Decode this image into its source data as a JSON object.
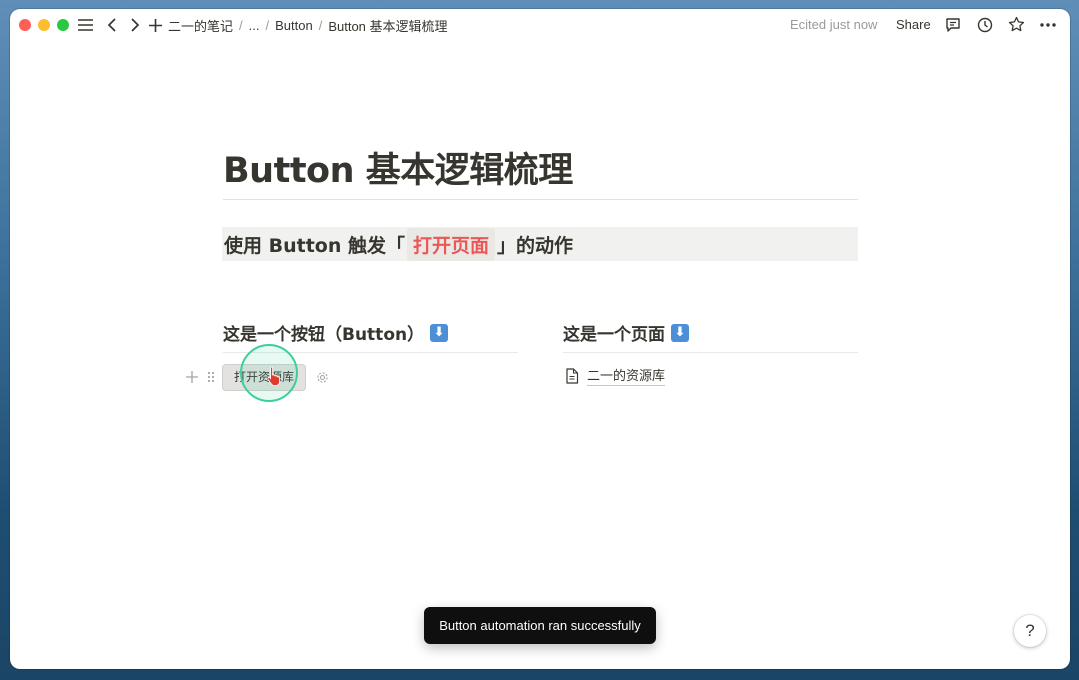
{
  "breadcrumb": {
    "items": [
      "二一的笔记",
      "...",
      "Button",
      "Button 基本逻辑梳理"
    ],
    "separator": "/"
  },
  "topbar": {
    "edited_text": "Ecited just now",
    "share_label": "Share"
  },
  "page": {
    "title": "Button 基本逻辑梳理",
    "callout": {
      "prefix": "使用 Button 触发「",
      "highlight": "打开页面",
      "suffix": "」的动作"
    },
    "left_column": {
      "heading": "这是一个按钮（Button）",
      "button_label": "打开资源库"
    },
    "right_column": {
      "heading": "这是一个页面",
      "page_link": "二一的资源库"
    }
  },
  "toast": {
    "message": "Button automation ran successfully"
  },
  "help": {
    "label": "?"
  },
  "icons": {
    "arrow_emoji": "⬇",
    "names": [
      "menu-icon",
      "back-icon",
      "forward-icon",
      "new-page-icon",
      "comment-icon",
      "clock-icon",
      "star-icon",
      "more-icon",
      "add-block-icon",
      "drag-handle-icon",
      "gear-icon",
      "page-icon",
      "cursor-icon"
    ]
  },
  "colors": {
    "code_text": "#eb5757",
    "callout_bg": "#f1f1ef",
    "ring": "#3bcf9a",
    "toast_bg": "#0f0f0f"
  }
}
